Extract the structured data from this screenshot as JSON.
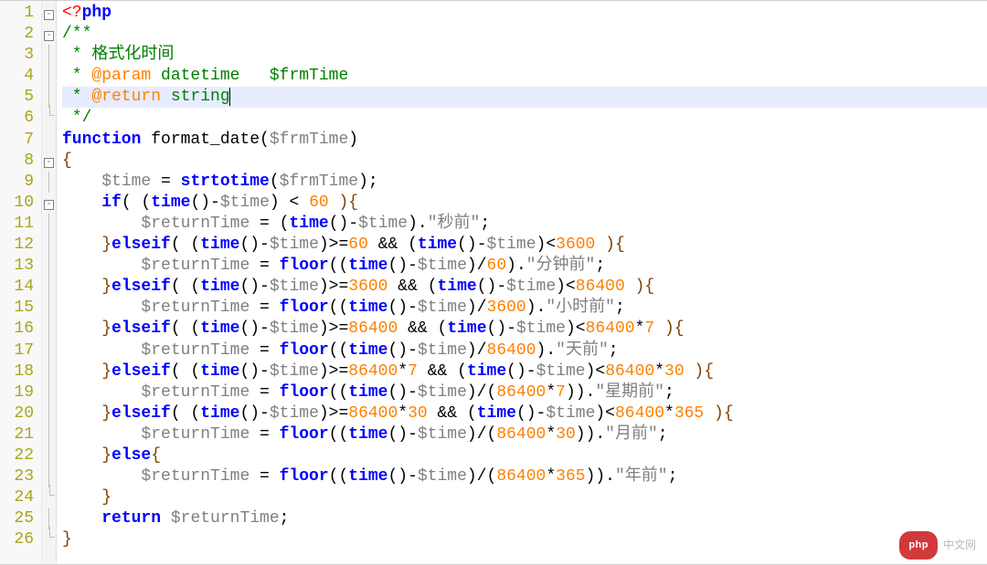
{
  "line_count": 26,
  "current_line_index": 4,
  "fold_markers": {
    "0": "box",
    "1": "box",
    "2": "bar",
    "3": "bar",
    "4": "bar",
    "5": "lbar",
    "6": "",
    "7": "box",
    "8": "bar",
    "9": "box",
    "10": "bar",
    "11": "bar",
    "12": "bar",
    "13": "bar",
    "14": "bar",
    "15": "bar",
    "16": "bar",
    "17": "bar",
    "18": "bar",
    "19": "bar",
    "20": "bar",
    "21": "bar",
    "22": "bar",
    "23": "lbar",
    "24": "bar",
    "25": "lbar"
  },
  "code_lines": [
    [
      [
        "<?",
        "red"
      ],
      [
        "php",
        "blue c-bold"
      ]
    ],
    [
      [
        "/**",
        "green"
      ]
    ],
    [
      [
        " * ",
        "green"
      ],
      [
        "格式化时间",
        "green"
      ]
    ],
    [
      [
        " * ",
        "green"
      ],
      [
        "@param",
        "org"
      ],
      [
        " datetime   $frmTime",
        "green"
      ]
    ],
    [
      [
        " * ",
        "green"
      ],
      [
        "@return",
        "org"
      ],
      [
        " string",
        "green"
      ],
      [
        "",
        "cursor"
      ]
    ],
    [
      [
        " */",
        "green"
      ]
    ],
    [
      [
        "function",
        "blue c-bold"
      ],
      [
        " format_date",
        "black"
      ],
      [
        "(",
        "black"
      ],
      [
        "$frmTime",
        "gray"
      ],
      [
        ")",
        "black"
      ]
    ],
    [
      [
        "{",
        "brown"
      ]
    ],
    [
      [
        "    ",
        "black"
      ],
      [
        "$time",
        "gray"
      ],
      [
        " = ",
        "black"
      ],
      [
        "strtotime",
        "blue c-bold"
      ],
      [
        "(",
        "black"
      ],
      [
        "$frmTime",
        "gray"
      ],
      [
        ");",
        "black"
      ]
    ],
    [
      [
        "    ",
        "black"
      ],
      [
        "if",
        "blue c-bold"
      ],
      [
        "( (",
        "black"
      ],
      [
        "time",
        "blue c-bold"
      ],
      [
        "()-",
        "black"
      ],
      [
        "$time",
        "gray"
      ],
      [
        ") < ",
        "black"
      ],
      [
        "60",
        "org"
      ],
      [
        " ){",
        "brown"
      ]
    ],
    [
      [
        "        ",
        "black"
      ],
      [
        "$returnTime",
        "gray"
      ],
      [
        " = (",
        "black"
      ],
      [
        "time",
        "blue c-bold"
      ],
      [
        "()-",
        "black"
      ],
      [
        "$time",
        "gray"
      ],
      [
        ").",
        "black"
      ],
      [
        "\"秒前\"",
        "gray"
      ],
      [
        ";",
        "black"
      ]
    ],
    [
      [
        "    }",
        "brown"
      ],
      [
        "elseif",
        "blue c-bold"
      ],
      [
        "( (",
        "black"
      ],
      [
        "time",
        "blue c-bold"
      ],
      [
        "()-",
        "black"
      ],
      [
        "$time",
        "gray"
      ],
      [
        ")>=",
        "black"
      ],
      [
        "60",
        "org"
      ],
      [
        " && (",
        "black"
      ],
      [
        "time",
        "blue c-bold"
      ],
      [
        "()-",
        "black"
      ],
      [
        "$time",
        "gray"
      ],
      [
        ")<",
        "black"
      ],
      [
        "3600",
        "org"
      ],
      [
        " ){",
        "brown"
      ]
    ],
    [
      [
        "        ",
        "black"
      ],
      [
        "$returnTime",
        "gray"
      ],
      [
        " = ",
        "black"
      ],
      [
        "floor",
        "blue c-bold"
      ],
      [
        "((",
        "black"
      ],
      [
        "time",
        "blue c-bold"
      ],
      [
        "()-",
        "black"
      ],
      [
        "$time",
        "gray"
      ],
      [
        ")/",
        "black"
      ],
      [
        "60",
        "org"
      ],
      [
        ").",
        "black"
      ],
      [
        "\"分钟前\"",
        "gray"
      ],
      [
        ";",
        "black"
      ]
    ],
    [
      [
        "    }",
        "brown"
      ],
      [
        "elseif",
        "blue c-bold"
      ],
      [
        "( (",
        "black"
      ],
      [
        "time",
        "blue c-bold"
      ],
      [
        "()-",
        "black"
      ],
      [
        "$time",
        "gray"
      ],
      [
        ")>=",
        "black"
      ],
      [
        "3600",
        "org"
      ],
      [
        " && (",
        "black"
      ],
      [
        "time",
        "blue c-bold"
      ],
      [
        "()-",
        "black"
      ],
      [
        "$time",
        "gray"
      ],
      [
        ")<",
        "black"
      ],
      [
        "86400",
        "org"
      ],
      [
        " ){",
        "brown"
      ]
    ],
    [
      [
        "        ",
        "black"
      ],
      [
        "$returnTime",
        "gray"
      ],
      [
        " = ",
        "black"
      ],
      [
        "floor",
        "blue c-bold"
      ],
      [
        "((",
        "black"
      ],
      [
        "time",
        "blue c-bold"
      ],
      [
        "()-",
        "black"
      ],
      [
        "$time",
        "gray"
      ],
      [
        ")/",
        "black"
      ],
      [
        "3600",
        "org"
      ],
      [
        ").",
        "black"
      ],
      [
        "\"小时前\"",
        "gray"
      ],
      [
        ";",
        "black"
      ]
    ],
    [
      [
        "    }",
        "brown"
      ],
      [
        "elseif",
        "blue c-bold"
      ],
      [
        "( (",
        "black"
      ],
      [
        "time",
        "blue c-bold"
      ],
      [
        "()-",
        "black"
      ],
      [
        "$time",
        "gray"
      ],
      [
        ")>=",
        "black"
      ],
      [
        "86400",
        "org"
      ],
      [
        " && (",
        "black"
      ],
      [
        "time",
        "blue c-bold"
      ],
      [
        "()-",
        "black"
      ],
      [
        "$time",
        "gray"
      ],
      [
        ")<",
        "black"
      ],
      [
        "86400",
        "org"
      ],
      [
        "*",
        "black"
      ],
      [
        "7",
        "org"
      ],
      [
        " ){",
        "brown"
      ]
    ],
    [
      [
        "        ",
        "black"
      ],
      [
        "$returnTime",
        "gray"
      ],
      [
        " = ",
        "black"
      ],
      [
        "floor",
        "blue c-bold"
      ],
      [
        "((",
        "black"
      ],
      [
        "time",
        "blue c-bold"
      ],
      [
        "()-",
        "black"
      ],
      [
        "$time",
        "gray"
      ],
      [
        ")/",
        "black"
      ],
      [
        "86400",
        "org"
      ],
      [
        ").",
        "black"
      ],
      [
        "\"天前\"",
        "gray"
      ],
      [
        ";",
        "black"
      ]
    ],
    [
      [
        "    }",
        "brown"
      ],
      [
        "elseif",
        "blue c-bold"
      ],
      [
        "( (",
        "black"
      ],
      [
        "time",
        "blue c-bold"
      ],
      [
        "()-",
        "black"
      ],
      [
        "$time",
        "gray"
      ],
      [
        ")>=",
        "black"
      ],
      [
        "86400",
        "org"
      ],
      [
        "*",
        "black"
      ],
      [
        "7",
        "org"
      ],
      [
        " && (",
        "black"
      ],
      [
        "time",
        "blue c-bold"
      ],
      [
        "()-",
        "black"
      ],
      [
        "$time",
        "gray"
      ],
      [
        ")<",
        "black"
      ],
      [
        "86400",
        "org"
      ],
      [
        "*",
        "black"
      ],
      [
        "30",
        "org"
      ],
      [
        " ){",
        "brown"
      ]
    ],
    [
      [
        "        ",
        "black"
      ],
      [
        "$returnTime",
        "gray"
      ],
      [
        " = ",
        "black"
      ],
      [
        "floor",
        "blue c-bold"
      ],
      [
        "((",
        "black"
      ],
      [
        "time",
        "blue c-bold"
      ],
      [
        "()-",
        "black"
      ],
      [
        "$time",
        "gray"
      ],
      [
        ")/(",
        "black"
      ],
      [
        "86400",
        "org"
      ],
      [
        "*",
        "black"
      ],
      [
        "7",
        "org"
      ],
      [
        ")).",
        "black"
      ],
      [
        "\"星期前\"",
        "gray"
      ],
      [
        ";",
        "black"
      ]
    ],
    [
      [
        "    }",
        "brown"
      ],
      [
        "elseif",
        "blue c-bold"
      ],
      [
        "( (",
        "black"
      ],
      [
        "time",
        "blue c-bold"
      ],
      [
        "()-",
        "black"
      ],
      [
        "$time",
        "gray"
      ],
      [
        ")>=",
        "black"
      ],
      [
        "86400",
        "org"
      ],
      [
        "*",
        "black"
      ],
      [
        "30",
        "org"
      ],
      [
        " && (",
        "black"
      ],
      [
        "time",
        "blue c-bold"
      ],
      [
        "()-",
        "black"
      ],
      [
        "$time",
        "gray"
      ],
      [
        ")<",
        "black"
      ],
      [
        "86400",
        "org"
      ],
      [
        "*",
        "black"
      ],
      [
        "365",
        "org"
      ],
      [
        " ){",
        "brown"
      ]
    ],
    [
      [
        "        ",
        "black"
      ],
      [
        "$returnTime",
        "gray"
      ],
      [
        " = ",
        "black"
      ],
      [
        "floor",
        "blue c-bold"
      ],
      [
        "((",
        "black"
      ],
      [
        "time",
        "blue c-bold"
      ],
      [
        "()-",
        "black"
      ],
      [
        "$time",
        "gray"
      ],
      [
        ")/(",
        "black"
      ],
      [
        "86400",
        "org"
      ],
      [
        "*",
        "black"
      ],
      [
        "30",
        "org"
      ],
      [
        ")).",
        "black"
      ],
      [
        "\"月前\"",
        "gray"
      ],
      [
        ";",
        "black"
      ]
    ],
    [
      [
        "    }",
        "brown"
      ],
      [
        "else",
        "blue c-bold"
      ],
      [
        "{",
        "brown"
      ]
    ],
    [
      [
        "        ",
        "black"
      ],
      [
        "$returnTime",
        "gray"
      ],
      [
        " = ",
        "black"
      ],
      [
        "floor",
        "blue c-bold"
      ],
      [
        "((",
        "black"
      ],
      [
        "time",
        "blue c-bold"
      ],
      [
        "()-",
        "black"
      ],
      [
        "$time",
        "gray"
      ],
      [
        ")/(",
        "black"
      ],
      [
        "86400",
        "org"
      ],
      [
        "*",
        "black"
      ],
      [
        "365",
        "org"
      ],
      [
        ")).",
        "black"
      ],
      [
        "\"年前\"",
        "gray"
      ],
      [
        ";",
        "black"
      ]
    ],
    [
      [
        "    }",
        "brown"
      ]
    ],
    [
      [
        "    ",
        "black"
      ],
      [
        "return",
        "blue c-bold"
      ],
      [
        " ",
        "black"
      ],
      [
        "$returnTime",
        "gray"
      ],
      [
        ";",
        "black"
      ]
    ],
    [
      [
        "}",
        "brown"
      ]
    ]
  ],
  "watermark": {
    "pill": "php",
    "text": "中文网"
  }
}
